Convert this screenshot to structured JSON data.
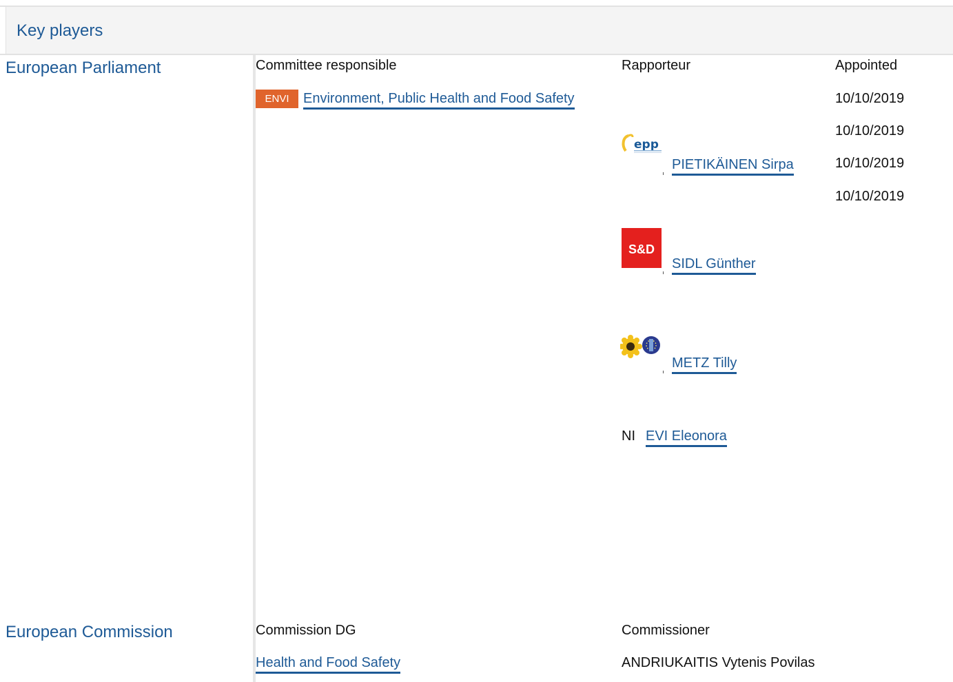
{
  "header": {
    "title": "Key players"
  },
  "parliament": {
    "institution": "European Parliament",
    "columns": {
      "committee": "Committee responsible",
      "rapporteur": "Rapporteur",
      "appointed": "Appointed"
    },
    "committee": {
      "abbr": "ENVI",
      "name": "Environment, Public Health and Food Safety"
    },
    "dates": [
      "10/10/2019",
      "10/10/2019",
      "10/10/2019",
      "10/10/2019"
    ],
    "rapporteurs": [
      {
        "group_logo": "epp-logo",
        "name": "PIETIKÄINEN Sirpa"
      },
      {
        "group_logo": "sd-logo",
        "logo_text": "S&D",
        "name": "SIDL Günther"
      },
      {
        "group_logo": "greens-efa-logo",
        "name": "METZ Tilly"
      },
      {
        "group": "NI",
        "name": "EVI Eleonora"
      }
    ],
    "colors": {
      "accent": "#1e5a96",
      "badge": "#e0642c",
      "sd_red": "#e4201e"
    }
  },
  "commission": {
    "institution": "European Commission",
    "columns": {
      "dg": "Commission DG",
      "commissioner": "Commissioner"
    },
    "dg": "Health and Food Safety",
    "commissioner": "ANDRIUKAITIS Vytenis Povilas"
  }
}
